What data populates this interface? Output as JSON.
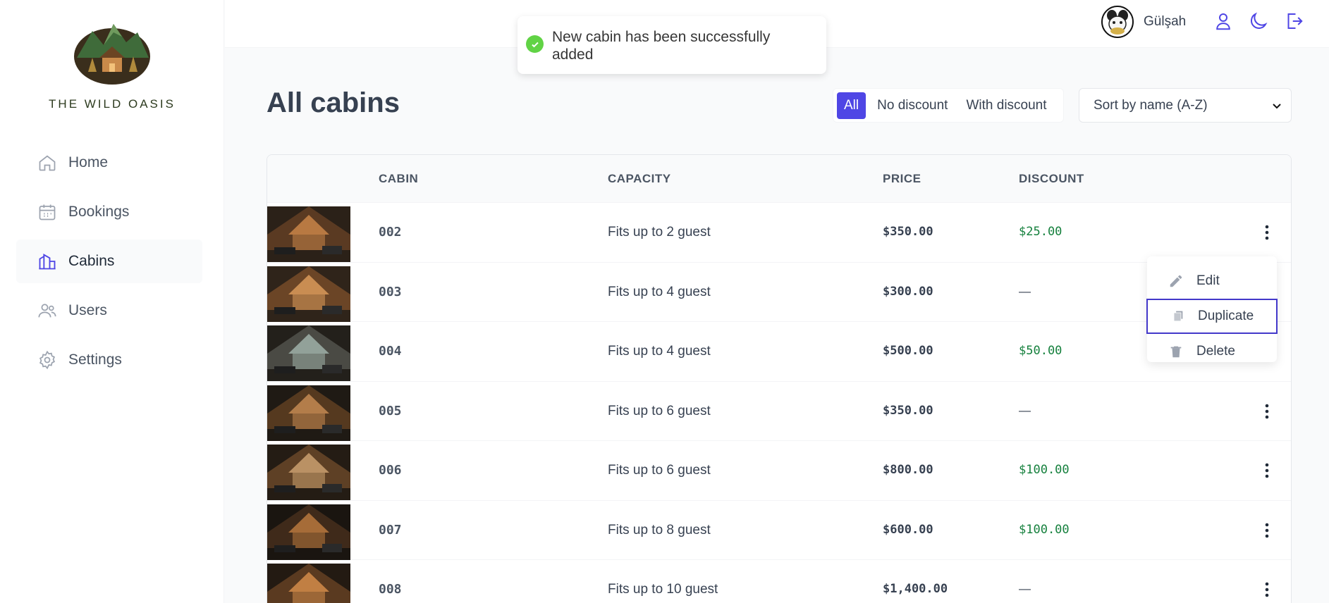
{
  "brand": {
    "name": "THE WILD OASIS"
  },
  "sidebar": {
    "items": [
      {
        "label": "Home",
        "icon": "home-icon",
        "active": false
      },
      {
        "label": "Bookings",
        "icon": "calendar-icon",
        "active": false
      },
      {
        "label": "Cabins",
        "icon": "cabin-icon",
        "active": true
      },
      {
        "label": "Users",
        "icon": "users-icon",
        "active": false
      },
      {
        "label": "Settings",
        "icon": "gear-icon",
        "active": false
      }
    ]
  },
  "header": {
    "user_name": "Gülşah",
    "icons": [
      "user-icon",
      "moon-icon",
      "logout-icon"
    ]
  },
  "toast": {
    "message": "New cabin has been successfully added",
    "status": "success",
    "status_color": "#61d345"
  },
  "main": {
    "title": "All cabins",
    "filters": [
      {
        "label": "All",
        "active": true
      },
      {
        "label": "No discount",
        "active": false
      },
      {
        "label": "With discount",
        "active": false
      }
    ],
    "sort_selected": "Sort by name (A-Z)"
  },
  "table": {
    "columns": [
      "CABIN",
      "CAPACITY",
      "PRICE",
      "DISCOUNT"
    ],
    "rows": [
      {
        "cabin": "002",
        "capacity": "Fits up to 2 guest",
        "price": "$350.00",
        "discount": "$25.00"
      },
      {
        "cabin": "003",
        "capacity": "Fits up to 4 guest",
        "price": "$300.00",
        "discount": "—"
      },
      {
        "cabin": "004",
        "capacity": "Fits up to 4 guest",
        "price": "$500.00",
        "discount": "$50.00"
      },
      {
        "cabin": "005",
        "capacity": "Fits up to 6 guest",
        "price": "$350.00",
        "discount": "—"
      },
      {
        "cabin": "006",
        "capacity": "Fits up to 6 guest",
        "price": "$800.00",
        "discount": "$100.00"
      },
      {
        "cabin": "007",
        "capacity": "Fits up to 8 guest",
        "price": "$600.00",
        "discount": "$100.00"
      },
      {
        "cabin": "008",
        "capacity": "Fits up to 10 guest",
        "price": "$1,400.00",
        "discount": "—"
      }
    ]
  },
  "menu": {
    "items": [
      {
        "label": "Edit",
        "icon": "pencil-icon"
      },
      {
        "label": "Duplicate",
        "icon": "duplicate-icon"
      },
      {
        "label": "Delete",
        "icon": "trash-icon"
      }
    ]
  },
  "colors": {
    "accent": "#4f46e5",
    "discount_green": "#15803d",
    "text": "#374151"
  }
}
